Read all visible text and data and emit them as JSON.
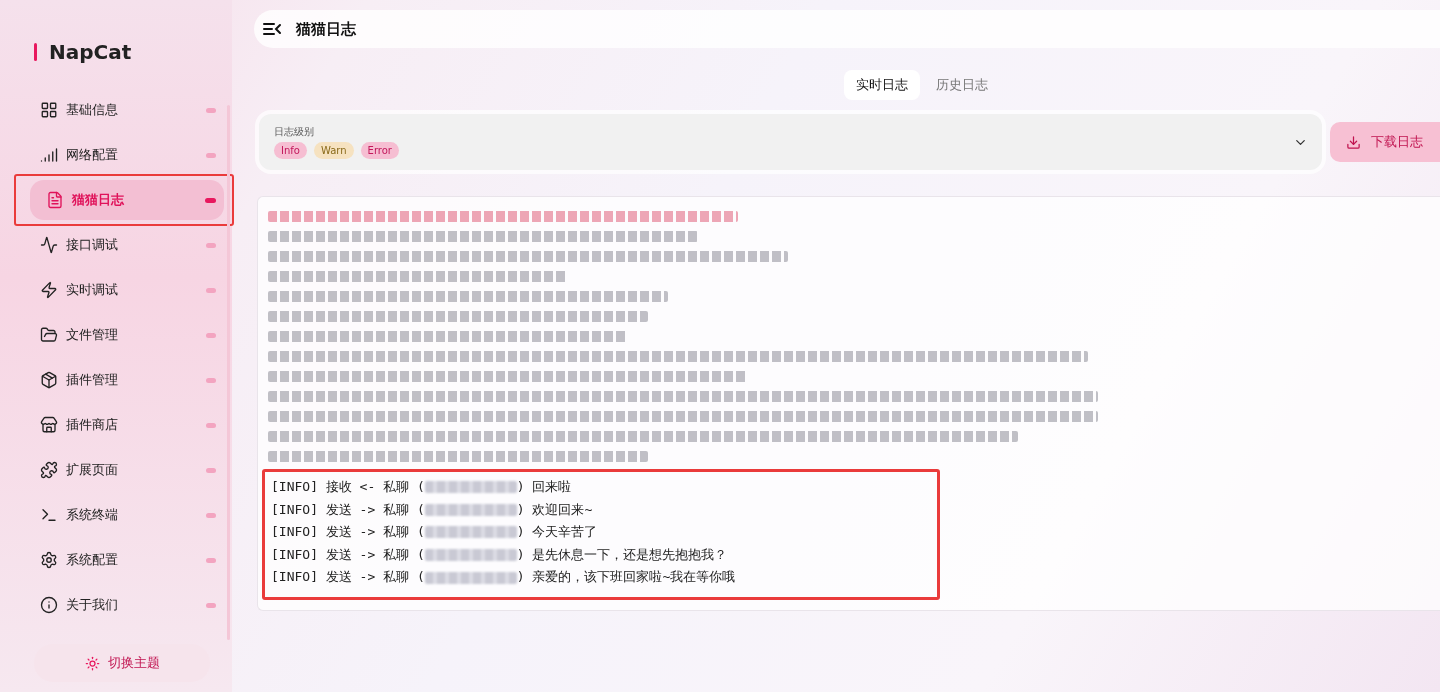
{
  "brand": "NapCat",
  "nav": [
    {
      "label": "基础信息",
      "selected": false,
      "highlighted": false
    },
    {
      "label": "网络配置",
      "selected": false,
      "highlighted": false
    },
    {
      "label": "猫猫日志",
      "selected": true,
      "highlighted": true
    },
    {
      "label": "接口调试",
      "selected": false,
      "highlighted": false
    },
    {
      "label": "实时调试",
      "selected": false,
      "highlighted": false
    },
    {
      "label": "文件管理",
      "selected": false,
      "highlighted": false
    },
    {
      "label": "插件管理",
      "selected": false,
      "highlighted": false
    },
    {
      "label": "插件商店",
      "selected": false,
      "highlighted": false
    },
    {
      "label": "扩展页面",
      "selected": false,
      "highlighted": false
    },
    {
      "label": "系统终端",
      "selected": false,
      "highlighted": false
    },
    {
      "label": "系统配置",
      "selected": false,
      "highlighted": false
    },
    {
      "label": "关于我们",
      "selected": false,
      "highlighted": false
    }
  ],
  "theme_button": "切换主题",
  "header": {
    "title": "猫猫日志"
  },
  "tabs": [
    {
      "label": "实时日志",
      "selected": true
    },
    {
      "label": "历史日志",
      "selected": false
    }
  ],
  "filter": {
    "label": "日志级别",
    "chips": [
      {
        "label": "Info",
        "kind": "info"
      },
      {
        "label": "Warn",
        "kind": "warn"
      },
      {
        "label": "Error",
        "kind": "error"
      }
    ]
  },
  "download_button": "下载日志",
  "redacted_lines": [
    {
      "kind": "error"
    },
    {
      "kind": "info"
    },
    {
      "kind": "info"
    },
    {
      "kind": "info"
    },
    {
      "kind": "info"
    },
    {
      "kind": "info"
    },
    {
      "kind": "info"
    },
    {
      "kind": "info"
    },
    {
      "kind": "info"
    },
    {
      "kind": "info"
    },
    {
      "kind": "info"
    },
    {
      "kind": "info"
    },
    {
      "kind": "info"
    }
  ],
  "log_group": {
    "highlighted": true,
    "lines": [
      {
        "prefix": "[INFO] 接收 <- 私聊 (",
        "suffix": ") 回来啦"
      },
      {
        "prefix": "[INFO] 发送 -> 私聊 (",
        "suffix": ") 欢迎回来~"
      },
      {
        "prefix": "[INFO] 发送 -> 私聊 (",
        "suffix": ") 今天辛苦了"
      },
      {
        "prefix": "[INFO] 发送 -> 私聊 (",
        "suffix": ") 是先休息一下，还是想先抱抱我？"
      },
      {
        "prefix": "[INFO] 发送 -> 私聊 (",
        "suffix": ") 亲爱的，该下班回家啦~我在等你哦"
      }
    ]
  }
}
